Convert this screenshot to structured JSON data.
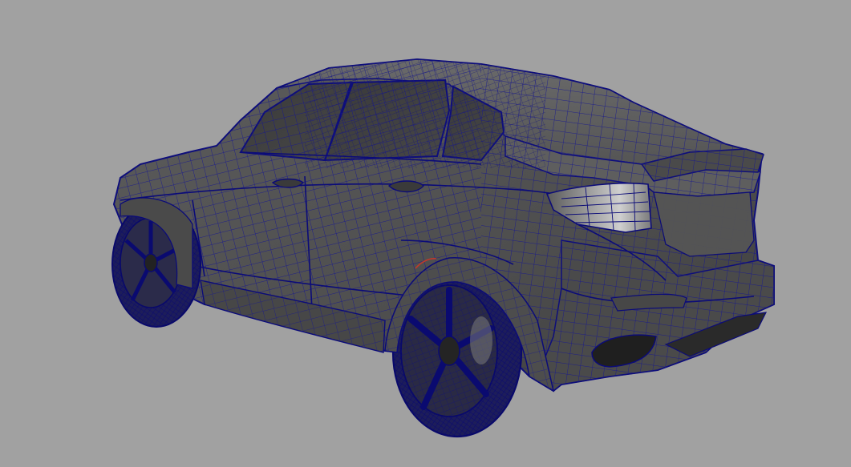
{
  "viewport": {
    "background_color": "#a1a1a1",
    "view_mode": "wireframe-on-shaded",
    "object": "car-mesh",
    "colors": {
      "shaded_body": "#545454",
      "shaded_dark": "#2e2e2e",
      "shaded_light": "#6e6e6e",
      "wire_edge": "#14148c",
      "wire_dense": "#0a0a6a",
      "selection_highlight": "#c0392b",
      "taillight_glass": "#d9d9d9"
    }
  }
}
